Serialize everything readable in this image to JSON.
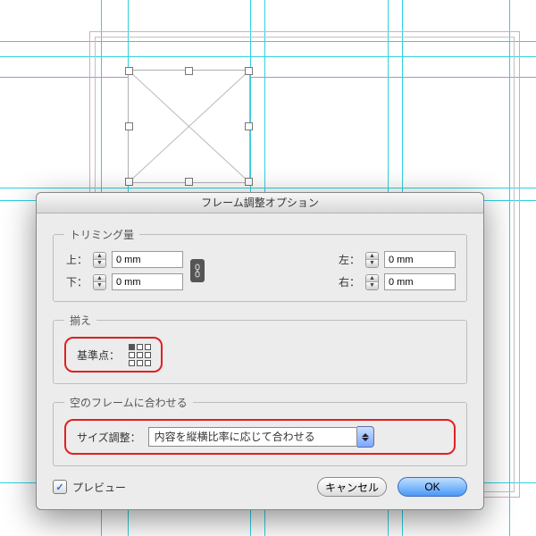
{
  "dialog": {
    "title": "フレーム調整オプション",
    "trim": {
      "legend": "トリミング量",
      "top_label": "上：",
      "bottom_label": "下：",
      "left_label": "左：",
      "right_label": "右：",
      "top": "0 mm",
      "bottom": "0 mm",
      "left": "0 mm",
      "right": "0 mm"
    },
    "align": {
      "legend": "揃え",
      "ref_label": "基準点："
    },
    "fit": {
      "legend": "空のフレームに合わせる",
      "label": "サイズ調整：",
      "value": "内容を縦横比率に応じて合わせる"
    },
    "preview_label": "プレビュー",
    "cancel": "キャンセル",
    "ok": "OK"
  }
}
